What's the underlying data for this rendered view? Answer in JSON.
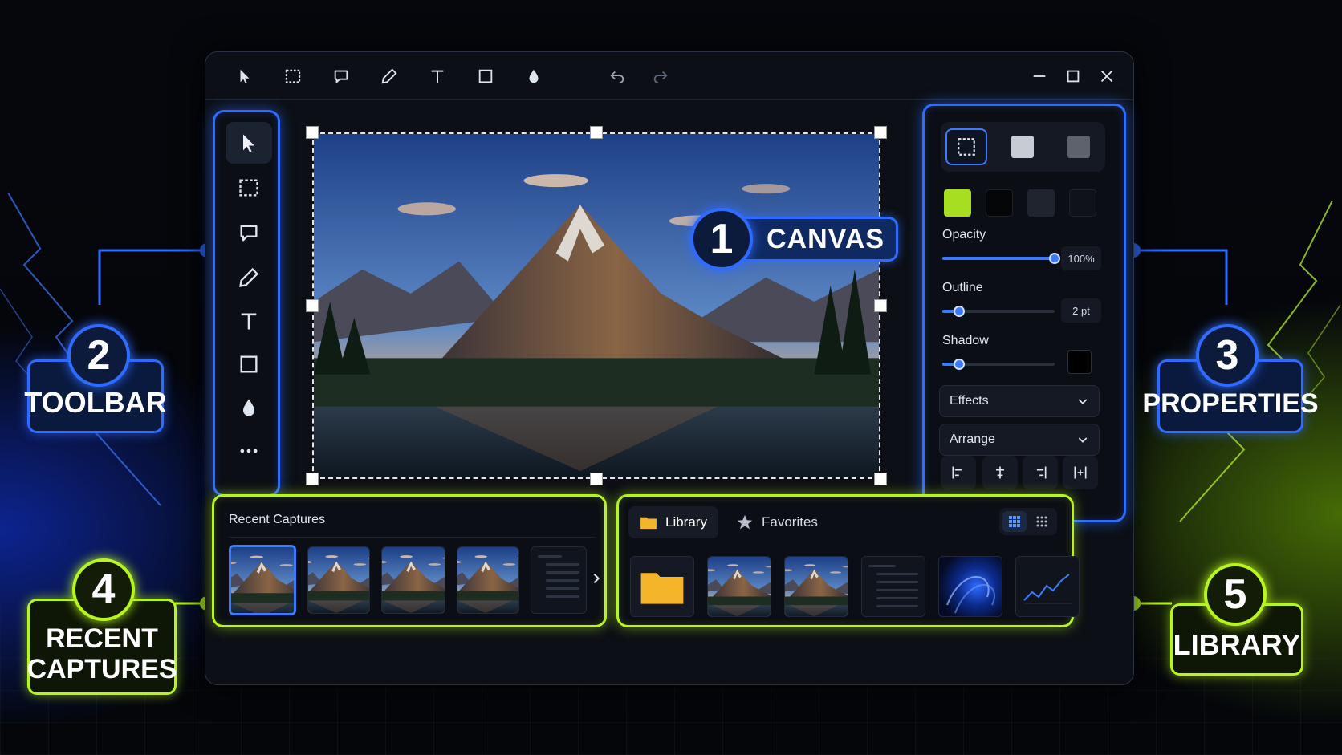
{
  "callouts": {
    "canvas": {
      "number": "1",
      "label": "CANVAS"
    },
    "toolbar": {
      "number": "2",
      "label": "TOOLBAR"
    },
    "properties": {
      "number": "3",
      "label": "PROPERTIES"
    },
    "recent": {
      "number": "4",
      "label_line1": "RECENT",
      "label_line2": "CAPTURES"
    },
    "library": {
      "number": "5",
      "label": "LIBRARY"
    }
  },
  "titlebar": {
    "tools": [
      "pointer-icon",
      "marquee-icon",
      "speech-bubble-icon",
      "pen-icon",
      "text-icon",
      "rectangle-icon",
      "blur-drop-icon"
    ],
    "history": [
      "undo-icon",
      "redo-icon"
    ],
    "window_controls": [
      "minimize-icon",
      "maximize-icon",
      "close-icon"
    ]
  },
  "toolbar": {
    "tools": [
      "pointer-icon",
      "marquee-icon",
      "speech-bubble-icon",
      "pen-icon",
      "text-icon",
      "rectangle-icon",
      "blur-drop-icon",
      "more-icon"
    ],
    "active": "pointer-icon"
  },
  "properties": {
    "shape_styles": [
      "outline-dashed",
      "fill-light",
      "fill-dark"
    ],
    "colors": [
      "#a7de20",
      "#050608",
      "#1f242e",
      "#0f1218"
    ],
    "opacity": {
      "label": "Opacity",
      "value_text": "100%",
      "value": 1.0
    },
    "outline": {
      "label": "Outline",
      "value_text": "2 pt",
      "value": 0.15
    },
    "shadow": {
      "label": "Shadow",
      "value": 0.15,
      "color": "#000000"
    },
    "effects_label": "Effects",
    "arrange_label": "Arrange",
    "align_buttons": [
      "align-left-icon",
      "align-center-icon",
      "align-right-icon",
      "distribute-icon"
    ]
  },
  "recent": {
    "title": "Recent Captures",
    "thumbnails": [
      "mountain-lake-1",
      "mountain-lake-2",
      "mountain-lake-3",
      "mountain-lake-4",
      "settings-list"
    ],
    "selected_index": 0,
    "next_icon": "chevron-right-icon"
  },
  "library": {
    "tabs": [
      {
        "label": "Library",
        "icon": "folder-icon",
        "active": true
      },
      {
        "label": "Favorites",
        "icon": "star-icon",
        "active": false
      }
    ],
    "view_modes": [
      "grid-large-icon",
      "grid-small-icon"
    ],
    "items": [
      "folder",
      "mountain-lake",
      "mountain-forest",
      "settings-list",
      "blue-swirl",
      "line-chart"
    ]
  },
  "colors": {
    "blue_accent": "#2f6bff",
    "green_accent": "#b6f51d",
    "folder": "#f4b52a"
  }
}
